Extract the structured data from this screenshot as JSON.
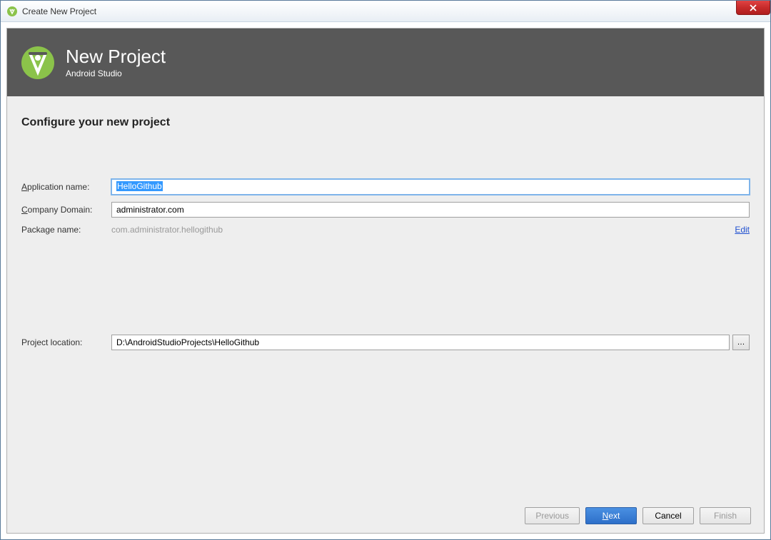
{
  "window": {
    "title": "Create New Project",
    "close_icon": "close-icon"
  },
  "header": {
    "title": "New Project",
    "subtitle": "Android Studio"
  },
  "content": {
    "section_heading": "Configure your new project",
    "labels": {
      "app_name_prefix": "A",
      "app_name_rest": "pplication name:",
      "company_prefix": "C",
      "company_rest": "ompany Domain:",
      "package_name": "Package name:",
      "project_location": "Project location:"
    },
    "fields": {
      "application_name": "HelloGithub",
      "company_domain": "administrator.com",
      "package_name": "com.administrator.hellogithub",
      "project_location": "D:\\AndroidStudioProjects\\HelloGithub"
    },
    "edit_link": "Edit",
    "browse_button": "…"
  },
  "buttons": {
    "previous": "Previous",
    "next_prefix": "N",
    "next_rest": "ext",
    "cancel": "Cancel",
    "finish": "Finish"
  }
}
